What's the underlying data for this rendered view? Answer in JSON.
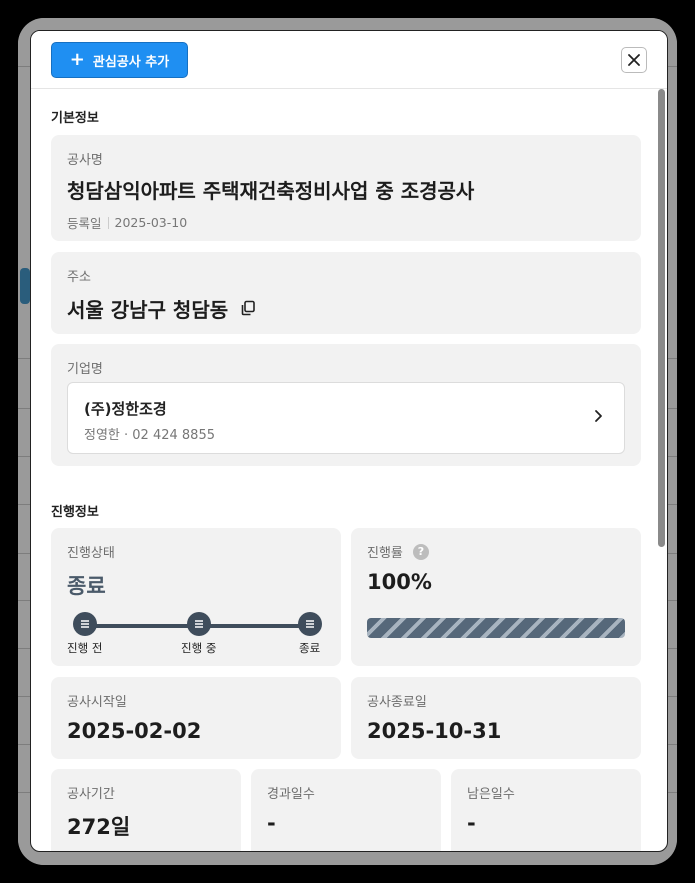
{
  "header": {
    "add_label": "관심공사 추가"
  },
  "basic_info": {
    "section_title": "기본정보",
    "project": {
      "label": "공사명",
      "name": "청담삼익아파트 주택재건축정비사업 중 조경공사",
      "registered_label": "등록일",
      "registered_date": "2025-03-10"
    },
    "address": {
      "label": "주소",
      "value": "서울 강남구 청담동"
    },
    "company": {
      "label": "기업명",
      "name": "(주)정한조경",
      "contact": "정영한 · 02 424 8855"
    }
  },
  "progress_info": {
    "section_title": "진행정보",
    "status": {
      "label": "진행상태",
      "value": "종료",
      "steps": [
        "진행 전",
        "진행 중",
        "종료"
      ]
    },
    "rate": {
      "label": "진행률",
      "value": "100%",
      "fraction": 1.0
    },
    "start": {
      "label": "공사시작일",
      "value": "2025-02-02"
    },
    "end": {
      "label": "공사종료일",
      "value": "2025-10-31"
    },
    "duration": {
      "label": "공사기간",
      "value": "272일"
    },
    "elapsed": {
      "label": "경과일수",
      "value": "-"
    },
    "remaining": {
      "label": "남은일수",
      "value": "-"
    }
  },
  "colors": {
    "accent": "#1f8ff2",
    "step": "#3f4d5c"
  }
}
